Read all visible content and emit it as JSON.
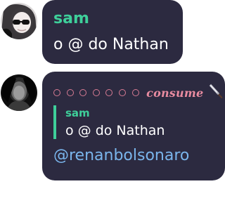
{
  "messages": [
    {
      "author": "sam",
      "text": "o @ do Nathan",
      "avatar": "profile-photo-girl-with-sunglasses"
    },
    {
      "author": "",
      "avatar": "profile-photo-dark-portrait",
      "header": {
        "decoration": "dotted-circles",
        "label": "consume",
        "icon": "knife-icon"
      },
      "quote": {
        "author": "sam",
        "text": "o @ do Nathan"
      },
      "mention": "@renanbolsonaro"
    }
  ],
  "colors": {
    "bubble": "#2c2a40",
    "author": "#3ecf9a",
    "text": "#ffffff",
    "mention": "#7ab5ec",
    "accent": "#e88ba0"
  }
}
